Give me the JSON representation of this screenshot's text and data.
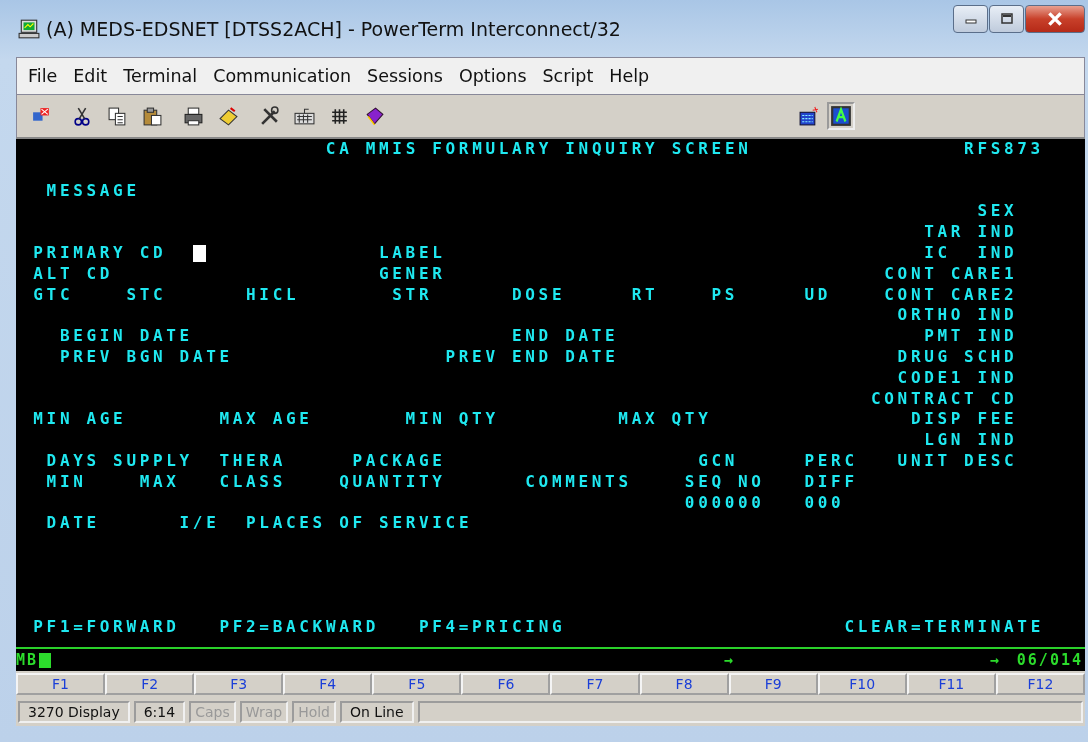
{
  "window": {
    "title": "(A) MEDS-EDSNET [DTSS2ACH] - PowerTerm Interconnect/32"
  },
  "menu": [
    "File",
    "Edit",
    "Terminal",
    "Communication",
    "Sessions",
    "Options",
    "Script",
    "Help"
  ],
  "screen": {
    "fields": [
      {
        "text": "CA MMIS FORMULARY INQUIRY SCREEN"
      },
      {
        "text": "RFS873"
      },
      {
        "text": "MESSAGE"
      },
      {
        "text": "SEX"
      },
      {
        "text": "TAR IND"
      },
      {
        "text": "PRIMARY CD"
      },
      {
        "text": "LABEL"
      },
      {
        "text": "IC  IND"
      },
      {
        "text": "ALT CD"
      },
      {
        "text": "GENER"
      },
      {
        "text": "CONT CARE1"
      },
      {
        "text": "GTC"
      },
      {
        "text": "STC"
      },
      {
        "text": "HICL"
      },
      {
        "text": "STR"
      },
      {
        "text": "DOSE"
      },
      {
        "text": "RT"
      },
      {
        "text": "PS"
      },
      {
        "text": "UD"
      },
      {
        "text": "CONT CARE2"
      },
      {
        "text": "ORTHO IND"
      },
      {
        "text": "BEGIN DATE"
      },
      {
        "text": "END DATE"
      },
      {
        "text": "PMT IND"
      },
      {
        "text": "PREV BGN DATE"
      },
      {
        "text": "PREV END DATE"
      },
      {
        "text": "DRUG SCHD"
      },
      {
        "text": "CODE1 IND"
      },
      {
        "text": "CONTRACT CD"
      },
      {
        "text": "MIN AGE"
      },
      {
        "text": "MAX AGE"
      },
      {
        "text": "MIN QTY"
      },
      {
        "text": "MAX QTY"
      },
      {
        "text": "DISP FEE"
      },
      {
        "text": "LGN IND"
      },
      {
        "text": "DAYS SUPPLY"
      },
      {
        "text": "THERA"
      },
      {
        "text": "PACKAGE"
      },
      {
        "text": "GCN"
      },
      {
        "text": "PERC"
      },
      {
        "text": "UNIT DESC"
      },
      {
        "text": "MIN"
      },
      {
        "text": "MAX"
      },
      {
        "text": "CLASS"
      },
      {
        "text": "QUANTITY"
      },
      {
        "text": "COMMENTS"
      },
      {
        "text": "SEQ NO"
      },
      {
        "text": "DIFF"
      },
      {
        "text": "000000"
      },
      {
        "text": "000"
      },
      {
        "text": "DATE"
      },
      {
        "text": "I/E"
      },
      {
        "text": "PLACES OF SERVICE"
      },
      {
        "text": "PF1=FORWARD"
      },
      {
        "text": "PF2=BACKWARD"
      },
      {
        "text": "PF4=PRICING"
      },
      {
        "text": "CLEAR=TERMINATE"
      }
    ]
  },
  "operator_line": {
    "left": "MB",
    "arrows": [
      "→",
      "→"
    ],
    "position": "06/014"
  },
  "function_keys": [
    "F1",
    "F2",
    "F3",
    "F4",
    "F5",
    "F6",
    "F7",
    "F8",
    "F9",
    "F10",
    "F11",
    "F12"
  ],
  "status_bar": [
    {
      "text": "3270 Display",
      "disabled": false
    },
    {
      "text": "6:14",
      "disabled": false
    },
    {
      "text": "Caps",
      "disabled": true
    },
    {
      "text": "Wrap",
      "disabled": true
    },
    {
      "text": "Hold",
      "disabled": true
    },
    {
      "text": "On Line",
      "disabled": false
    }
  ]
}
